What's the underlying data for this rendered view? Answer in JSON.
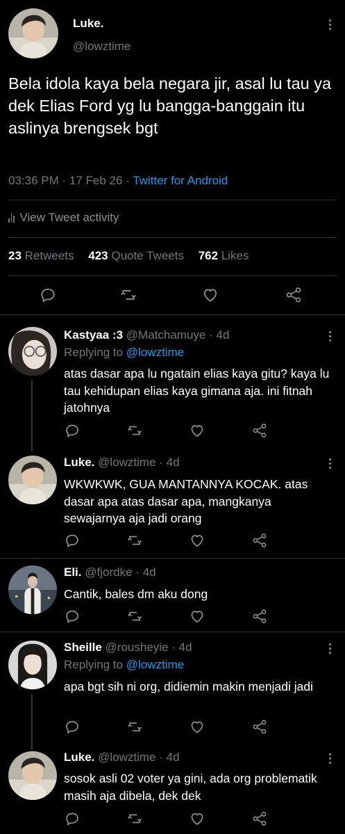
{
  "main_tweet": {
    "author_name": "Luke.",
    "author_handle": "@lowztime",
    "text": "Bela idola kaya bela negara jir, asal lu tau ya dek Elias Ford yg lu bangga-banggain itu aslinya brengsek bgt",
    "time": "03:36 PM",
    "date": "17 Feb 26",
    "source": "Twitter for Android",
    "separator": "·",
    "view_activity": "View Tweet activity",
    "retweets_count": "23",
    "retweets_label": "Retweets",
    "quotes_count": "423",
    "quotes_label": "Quote Tweets",
    "likes_count": "762",
    "likes_label": "Likes"
  },
  "replies": [
    {
      "name": "Kastyaa :3",
      "handle": "@Matchamuye",
      "age": "4d",
      "replying_prefix": "Replying to",
      "replying_to": "@lowztime",
      "text": "atas dasar apa lu ngatain elias kaya gitu? kaya lu tau kehidupan elias kaya gimana aja. ini fitnah jatohnya"
    },
    {
      "name": "Luke.",
      "handle": "@lowztime",
      "age": "4d",
      "text": "WKWKWK, GUA MANTANNYA KOCAK. atas dasar apa atas dasar apa, mangkanya sewajarnya aja jadi orang"
    },
    {
      "name": "Eli.",
      "handle": "@fjordke",
      "age": "4d",
      "text": "Cantik, bales dm aku dong"
    },
    {
      "name": "Sheille",
      "handle": "@rousheyie",
      "age": "4d",
      "replying_prefix": "Replying to",
      "replying_to": "@lowztime",
      "text": "apa bgt sih ni org, didiemin makin menjadi jadi"
    },
    {
      "name": "Luke.",
      "handle": "@lowztime",
      "age": "4d",
      "text": "sosok asli 02 voter ya gini, ada org problematik masih aja dibela, dek dek"
    }
  ],
  "icons": {
    "reply": "speech-bubble-icon",
    "retweet": "retweet-icon",
    "like": "heart-icon",
    "share": "share-icon",
    "more": "more-vertical-icon"
  },
  "colors": {
    "background": "#000000",
    "link": "#1d9bf0",
    "muted": "#71767b",
    "divider": "#2f3336"
  }
}
